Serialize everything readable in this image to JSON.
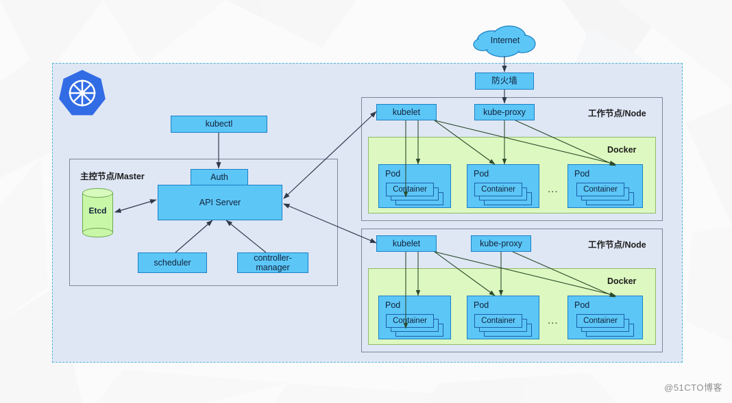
{
  "meta": {
    "watermark": "@51CTO博客",
    "colors": {
      "node_fill": "#5cc6f7",
      "node_stroke": "#1b7fc4",
      "panel_fill": "#dfe7f5",
      "panel_stroke": "#7d8598",
      "docker_fill": "#ddf8c0",
      "docker_stroke": "#8fb96a",
      "etcd_fill": "#c9f7a8",
      "cluster_dash": "#4fb6d8",
      "k8s_blue": "#326ce5",
      "arrow": "#2f3b4c"
    }
  },
  "cluster": {
    "logo_name": "kubernetes-logo"
  },
  "internet": {
    "label": "Internet"
  },
  "firewall": {
    "label": "防火墙"
  },
  "master": {
    "title": "主控节点/Master",
    "kubectl": "kubectl",
    "auth": "Auth",
    "api_server": "API Server",
    "etcd": "Etcd",
    "scheduler": "scheduler",
    "controller_manager_line1": "controller-",
    "controller_manager_line2": "manager"
  },
  "nodes": [
    {
      "title": "工作节点/Node",
      "kubelet": "kubelet",
      "kube_proxy": "kube-proxy",
      "docker": "Docker",
      "ellipsis": "...",
      "pods": [
        {
          "label": "Pod",
          "container": "Container"
        },
        {
          "label": "Pod",
          "container": "Container"
        },
        {
          "label": "Pod",
          "container": "Container"
        }
      ]
    },
    {
      "title": "工作节点/Node",
      "kubelet": "kubelet",
      "kube_proxy": "kube-proxy",
      "docker": "Docker",
      "ellipsis": "...",
      "pods": [
        {
          "label": "Pod",
          "container": "Container"
        },
        {
          "label": "Pod",
          "container": "Container"
        },
        {
          "label": "Pod",
          "container": "Container"
        }
      ]
    }
  ]
}
